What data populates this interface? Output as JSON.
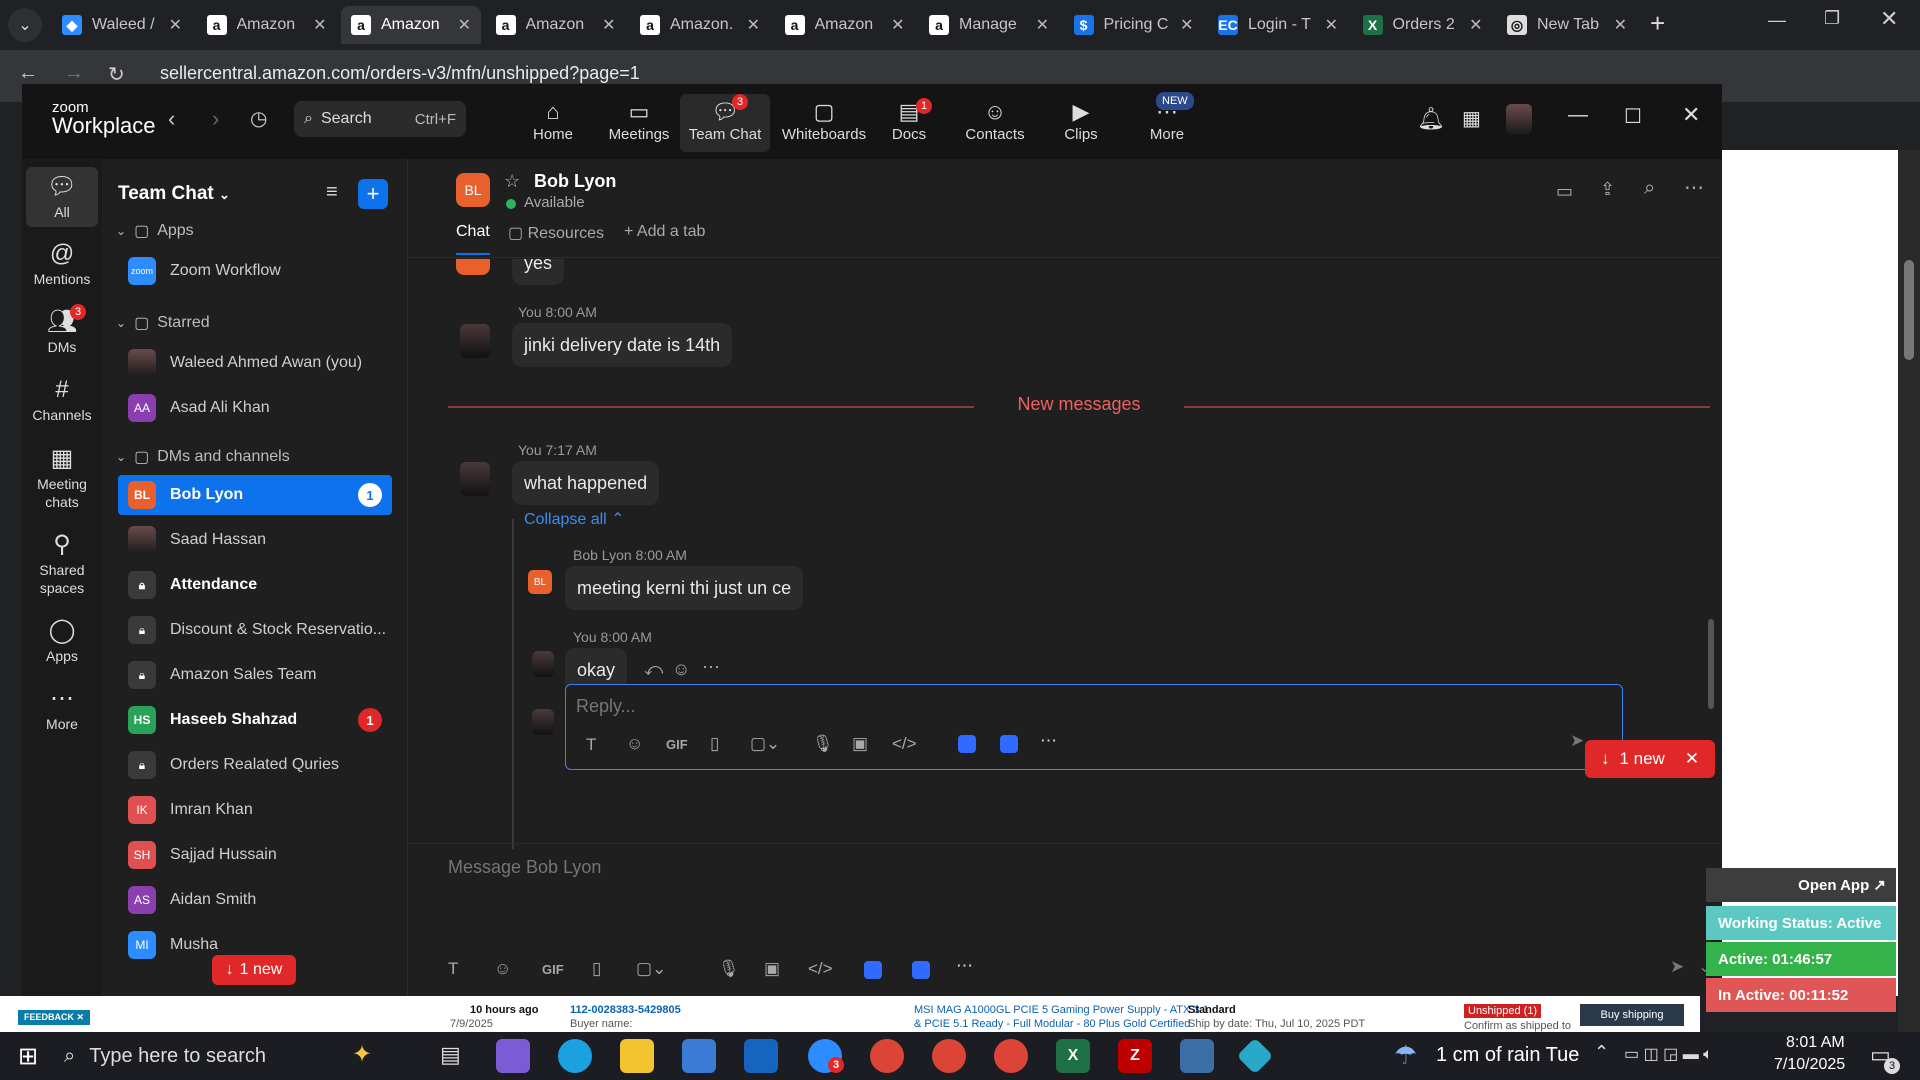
{
  "browser": {
    "tabs": [
      {
        "label": "Waleed /",
        "icon": "tab-favicon-zoom"
      },
      {
        "label": "Amazon",
        "icon": "tab-favicon-amazon"
      },
      {
        "label": "Amazon",
        "icon": "tab-favicon-amazon",
        "active": true
      },
      {
        "label": "Amazon",
        "icon": "tab-favicon-amazon"
      },
      {
        "label": "Amazon.",
        "icon": "tab-favicon-amazon"
      },
      {
        "label": "Amazon",
        "icon": "tab-favicon-amazon"
      },
      {
        "label": "Manage",
        "icon": "tab-favicon-amazon"
      },
      {
        "label": "Pricing C",
        "icon": "tab-favicon-dollar"
      },
      {
        "label": "Login - T",
        "icon": "tab-favicon-ec"
      },
      {
        "label": "Orders 2",
        "icon": "tab-favicon-excel"
      },
      {
        "label": "New Tab",
        "icon": "tab-favicon-chrome"
      }
    ],
    "url": "sellercentral.amazon.com/orders-v3/mfn/unshipped?page=1"
  },
  "zoom": {
    "logo_top": "zoom",
    "logo_bottom": "Workplace",
    "search_label": "Search",
    "search_shortcut": "Ctrl+F",
    "nav": [
      {
        "label": "Home",
        "icon": "home-icon"
      },
      {
        "label": "Meetings",
        "icon": "video-camera-icon"
      },
      {
        "label": "Team Chat",
        "icon": "chat-icon",
        "badge": "3",
        "active": true
      },
      {
        "label": "Whiteboards",
        "icon": "whiteboard-icon"
      },
      {
        "label": "Docs",
        "icon": "docs-icon",
        "badge": "1"
      },
      {
        "label": "Contacts",
        "icon": "contacts-icon"
      },
      {
        "label": "Clips",
        "icon": "clips-icon"
      },
      {
        "label": "More",
        "icon": "more-icon",
        "tag": "NEW"
      }
    ],
    "rail": [
      {
        "label": "All",
        "icon": "chat-bubble-icon",
        "active": true
      },
      {
        "label": "Mentions",
        "icon": "at-icon"
      },
      {
        "label": "DMs",
        "icon": "people-icon",
        "badge": "3"
      },
      {
        "label": "Channels",
        "icon": "hash-icon"
      },
      {
        "label": "Meeting chats",
        "icon": "calendar-icon"
      },
      {
        "label": "Shared spaces",
        "icon": "shared-icon"
      },
      {
        "label": "Apps",
        "icon": "apps-icon"
      },
      {
        "label": "More",
        "icon": "more-dots-icon"
      }
    ],
    "sidebar": {
      "title": "Team Chat",
      "sections": {
        "apps": "Apps",
        "starred": "Starred",
        "dms": "DMs and channels"
      },
      "apps_items": [
        {
          "label": "Zoom Workflow",
          "avatar": "zoom"
        }
      ],
      "starred_items": [
        {
          "label": "Waleed Ahmed Awan (you)",
          "avatar": ""
        },
        {
          "label": "Asad Ali Khan",
          "avatar": "AA"
        }
      ],
      "dm_items": [
        {
          "label": "Bob Lyon",
          "avatar": "BL",
          "count": "1",
          "selected": true
        },
        {
          "label": "Saad Hassan",
          "avatar": ""
        },
        {
          "label": "Attendance",
          "avatar": "lock",
          "bold": true
        },
        {
          "label": "Discount & Stock Reservatio...",
          "avatar": "lock"
        },
        {
          "label": "Amazon Sales Team",
          "avatar": "lock"
        },
        {
          "label": "Haseeb Shahzad",
          "avatar": "HS",
          "count": "1",
          "bold": true
        },
        {
          "label": "Orders Realated Quries",
          "avatar": "lock"
        },
        {
          "label": "Imran Khan",
          "avatar": "IK"
        },
        {
          "label": "Sajjad Hussain",
          "avatar": "SH"
        },
        {
          "label": "Aidan Smith",
          "avatar": "AS"
        },
        {
          "label": "Musha",
          "avatar": "MI"
        }
      ],
      "new_jump": "1 new"
    },
    "chat": {
      "contact_initials": "BL",
      "contact_name": "Bob Lyon",
      "contact_status": "Available",
      "tabs": {
        "chat": "Chat",
        "resources": "Resources",
        "add": "Add a tab"
      },
      "top_partial": "yes",
      "msg1_meta": "You 8:00 AM",
      "msg1_text": "jinki delivery date is 14th",
      "divider": "New messages",
      "msg2_meta": "You 7:17 AM",
      "msg2_text": "what happened",
      "collapse": "Collapse all",
      "reply1_meta": "Bob Lyon 8:00 AM",
      "reply1_initials": "BL",
      "reply1_text": "meeting kerni thi just un ce",
      "reply2_meta": "You 8:00 AM",
      "reply2_text": "okay",
      "reply_placeholder": "Reply...",
      "gif_label": "GIF",
      "new_jump": "1 new",
      "composer_placeholder": "Message Bob Lyon"
    }
  },
  "page_behind": {
    "feedback": "FEEDBACK",
    "order_age": "10 hours ago",
    "order_date": "7/9/2025",
    "order_id": "112-0028383-5429805",
    "buyer": "Buyer name:",
    "product": "MSI MAG A1000GL PCIE 5 Gaming Power Supply - ATX 3.1",
    "product2": "& PCIE 5.1 Ready - Full Modular - 80 Plus Gold Certified",
    "service": "Standard",
    "ship_by": "Ship by date: Thu, Jul 10, 2025 PDT",
    "status": "Unshipped (1)",
    "confirm": "Confirm as shipped to",
    "buy_shipping": "Buy shipping",
    "open_app": "Open App ↗",
    "working": "Working Status: Active",
    "active": "Active: 01:46:57",
    "inactive": "In Active: 00:11:52"
  },
  "taskbar": {
    "search": "Type here to search",
    "weather": "1 cm of rain Tue",
    "time": "8:01 AM",
    "date": "7/10/2025",
    "notif_count": "3",
    "outlook_badge": "3"
  }
}
